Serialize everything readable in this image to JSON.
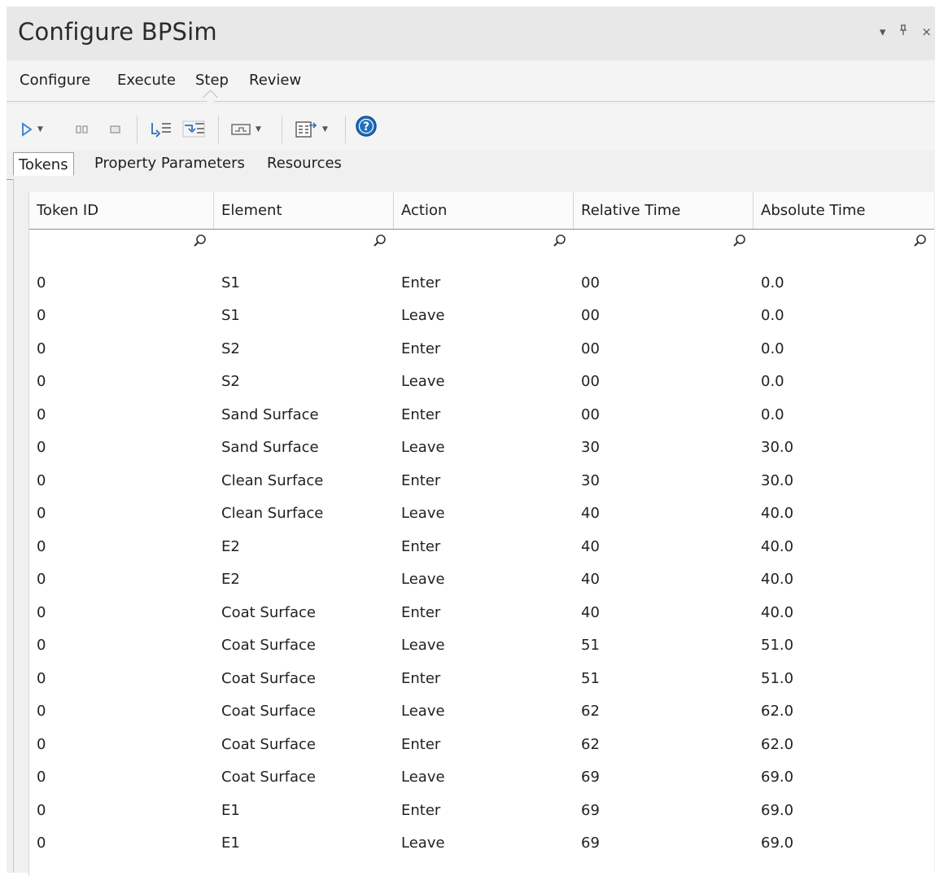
{
  "window": {
    "title": "Configure BPSim",
    "controls": {
      "dropdown_glyph": "▾",
      "pin_glyph": "⫧",
      "close_glyph": "×"
    }
  },
  "ribbon": {
    "tabs": [
      "Configure",
      "Execute",
      "Step",
      "Review"
    ],
    "active_tab": "Step"
  },
  "toolbar": {
    "icons": [
      "play-icon",
      "pause-icon",
      "stop-icon",
      "step-into-icon",
      "step-over-icon",
      "view-icon",
      "export-icon",
      "help-icon"
    ]
  },
  "subtabs": {
    "items": [
      "Tokens",
      "Property Parameters",
      "Resources"
    ],
    "active": "Tokens"
  },
  "table": {
    "columns": [
      "Token ID",
      "Element",
      "Action",
      "Relative Time",
      "Absolute Time"
    ],
    "filter_placeholder": "",
    "rows": [
      [
        "0",
        "S1",
        "Enter",
        "00",
        "0.0"
      ],
      [
        "0",
        "S1",
        "Leave",
        "00",
        "0.0"
      ],
      [
        "0",
        "S2",
        "Enter",
        "00",
        "0.0"
      ],
      [
        "0",
        "S2",
        "Leave",
        "00",
        "0.0"
      ],
      [
        "0",
        "Sand Surface",
        "Enter",
        "00",
        "0.0"
      ],
      [
        "0",
        "Sand Surface",
        "Leave",
        "30",
        "30.0"
      ],
      [
        "0",
        "Clean Surface",
        "Enter",
        "30",
        "30.0"
      ],
      [
        "0",
        "Clean Surface",
        "Leave",
        "40",
        "40.0"
      ],
      [
        "0",
        "E2",
        "Enter",
        "40",
        "40.0"
      ],
      [
        "0",
        "E2",
        "Leave",
        "40",
        "40.0"
      ],
      [
        "0",
        "Coat Surface",
        "Enter",
        "40",
        "40.0"
      ],
      [
        "0",
        "Coat Surface",
        "Leave",
        "51",
        "51.0"
      ],
      [
        "0",
        "Coat Surface",
        "Enter",
        "51",
        "51.0"
      ],
      [
        "0",
        "Coat Surface",
        "Leave",
        "62",
        "62.0"
      ],
      [
        "0",
        "Coat Surface",
        "Enter",
        "62",
        "62.0"
      ],
      [
        "0",
        "Coat Surface",
        "Leave",
        "69",
        "69.0"
      ],
      [
        "0",
        "E1",
        "Enter",
        "69",
        "69.0"
      ],
      [
        "0",
        "E1",
        "Leave",
        "69",
        "69.0"
      ]
    ]
  },
  "colors": {
    "play": "#2f7fd0",
    "help": "#1f6fbf",
    "accent": "#3a3a3a"
  }
}
